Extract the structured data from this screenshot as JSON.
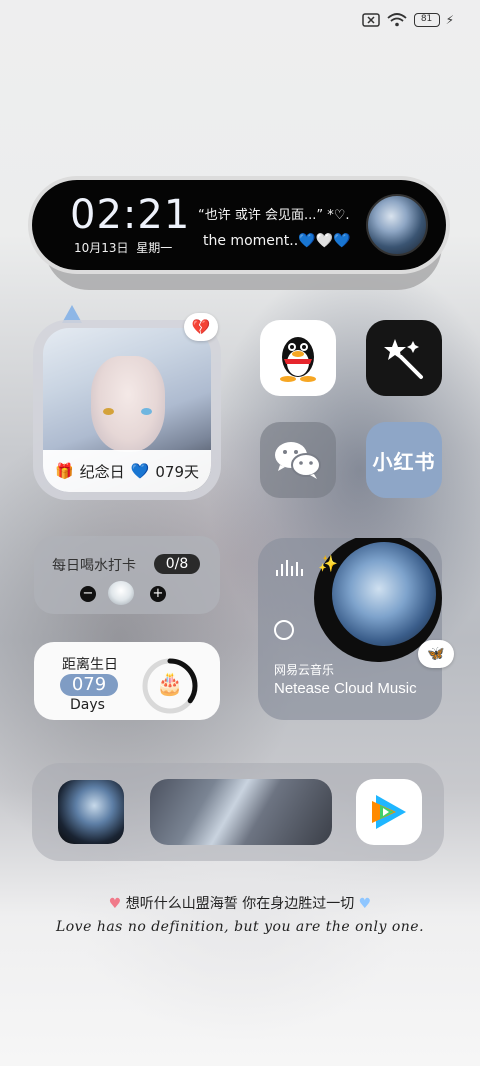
{
  "status_bar": {
    "sim_icon": "no-sim-icon",
    "wifi_icon": "wifi-icon",
    "wifi_label": "6",
    "battery_level": "81",
    "charging_icon": "charging-bolt-icon"
  },
  "clock_widget": {
    "time": "02:21",
    "date": "10月13日",
    "weekday": "星期一",
    "quote_line1": "“也许 或许 会见面...” *♡.",
    "quote_line2": "the moment..",
    "quote_hearts": "💙🤍💙"
  },
  "anniversary_widget": {
    "label": "纪念日",
    "days": "079天",
    "heart": "💙",
    "gift_icon": "🎁",
    "badge": "💔"
  },
  "apps": {
    "qq": "qq-app",
    "magic": "magic-wand-app",
    "wechat": "wechat-app",
    "xiaohongshu_label": "小红书"
  },
  "water_widget": {
    "title": "每日喝水打卡",
    "count": "0/8",
    "minus": "−",
    "plus": "+"
  },
  "birthday_widget": {
    "title": "距离生日",
    "days": "079",
    "unit": "Days",
    "cake": "🎂",
    "progress_fraction": 0.35
  },
  "music_widget": {
    "sparkle": "✨",
    "app_name_cn": "网易云音乐",
    "app_name_en": "Netease Cloud Music",
    "badge": "🦋"
  },
  "dock": {
    "items": [
      "photo-shortcut",
      "ocean-wave-widget",
      "tencent-video-app"
    ]
  },
  "footer": {
    "heart_left": "♥",
    "line_cn": "想听什么山盟海誓 你在身边胜过一切",
    "heart_right": "♥",
    "line_en": "Love has no definition, but you are the only one."
  },
  "colors": {
    "accent_blue": "#7f9cc4",
    "xhs_bg": "#8ea6c7"
  }
}
